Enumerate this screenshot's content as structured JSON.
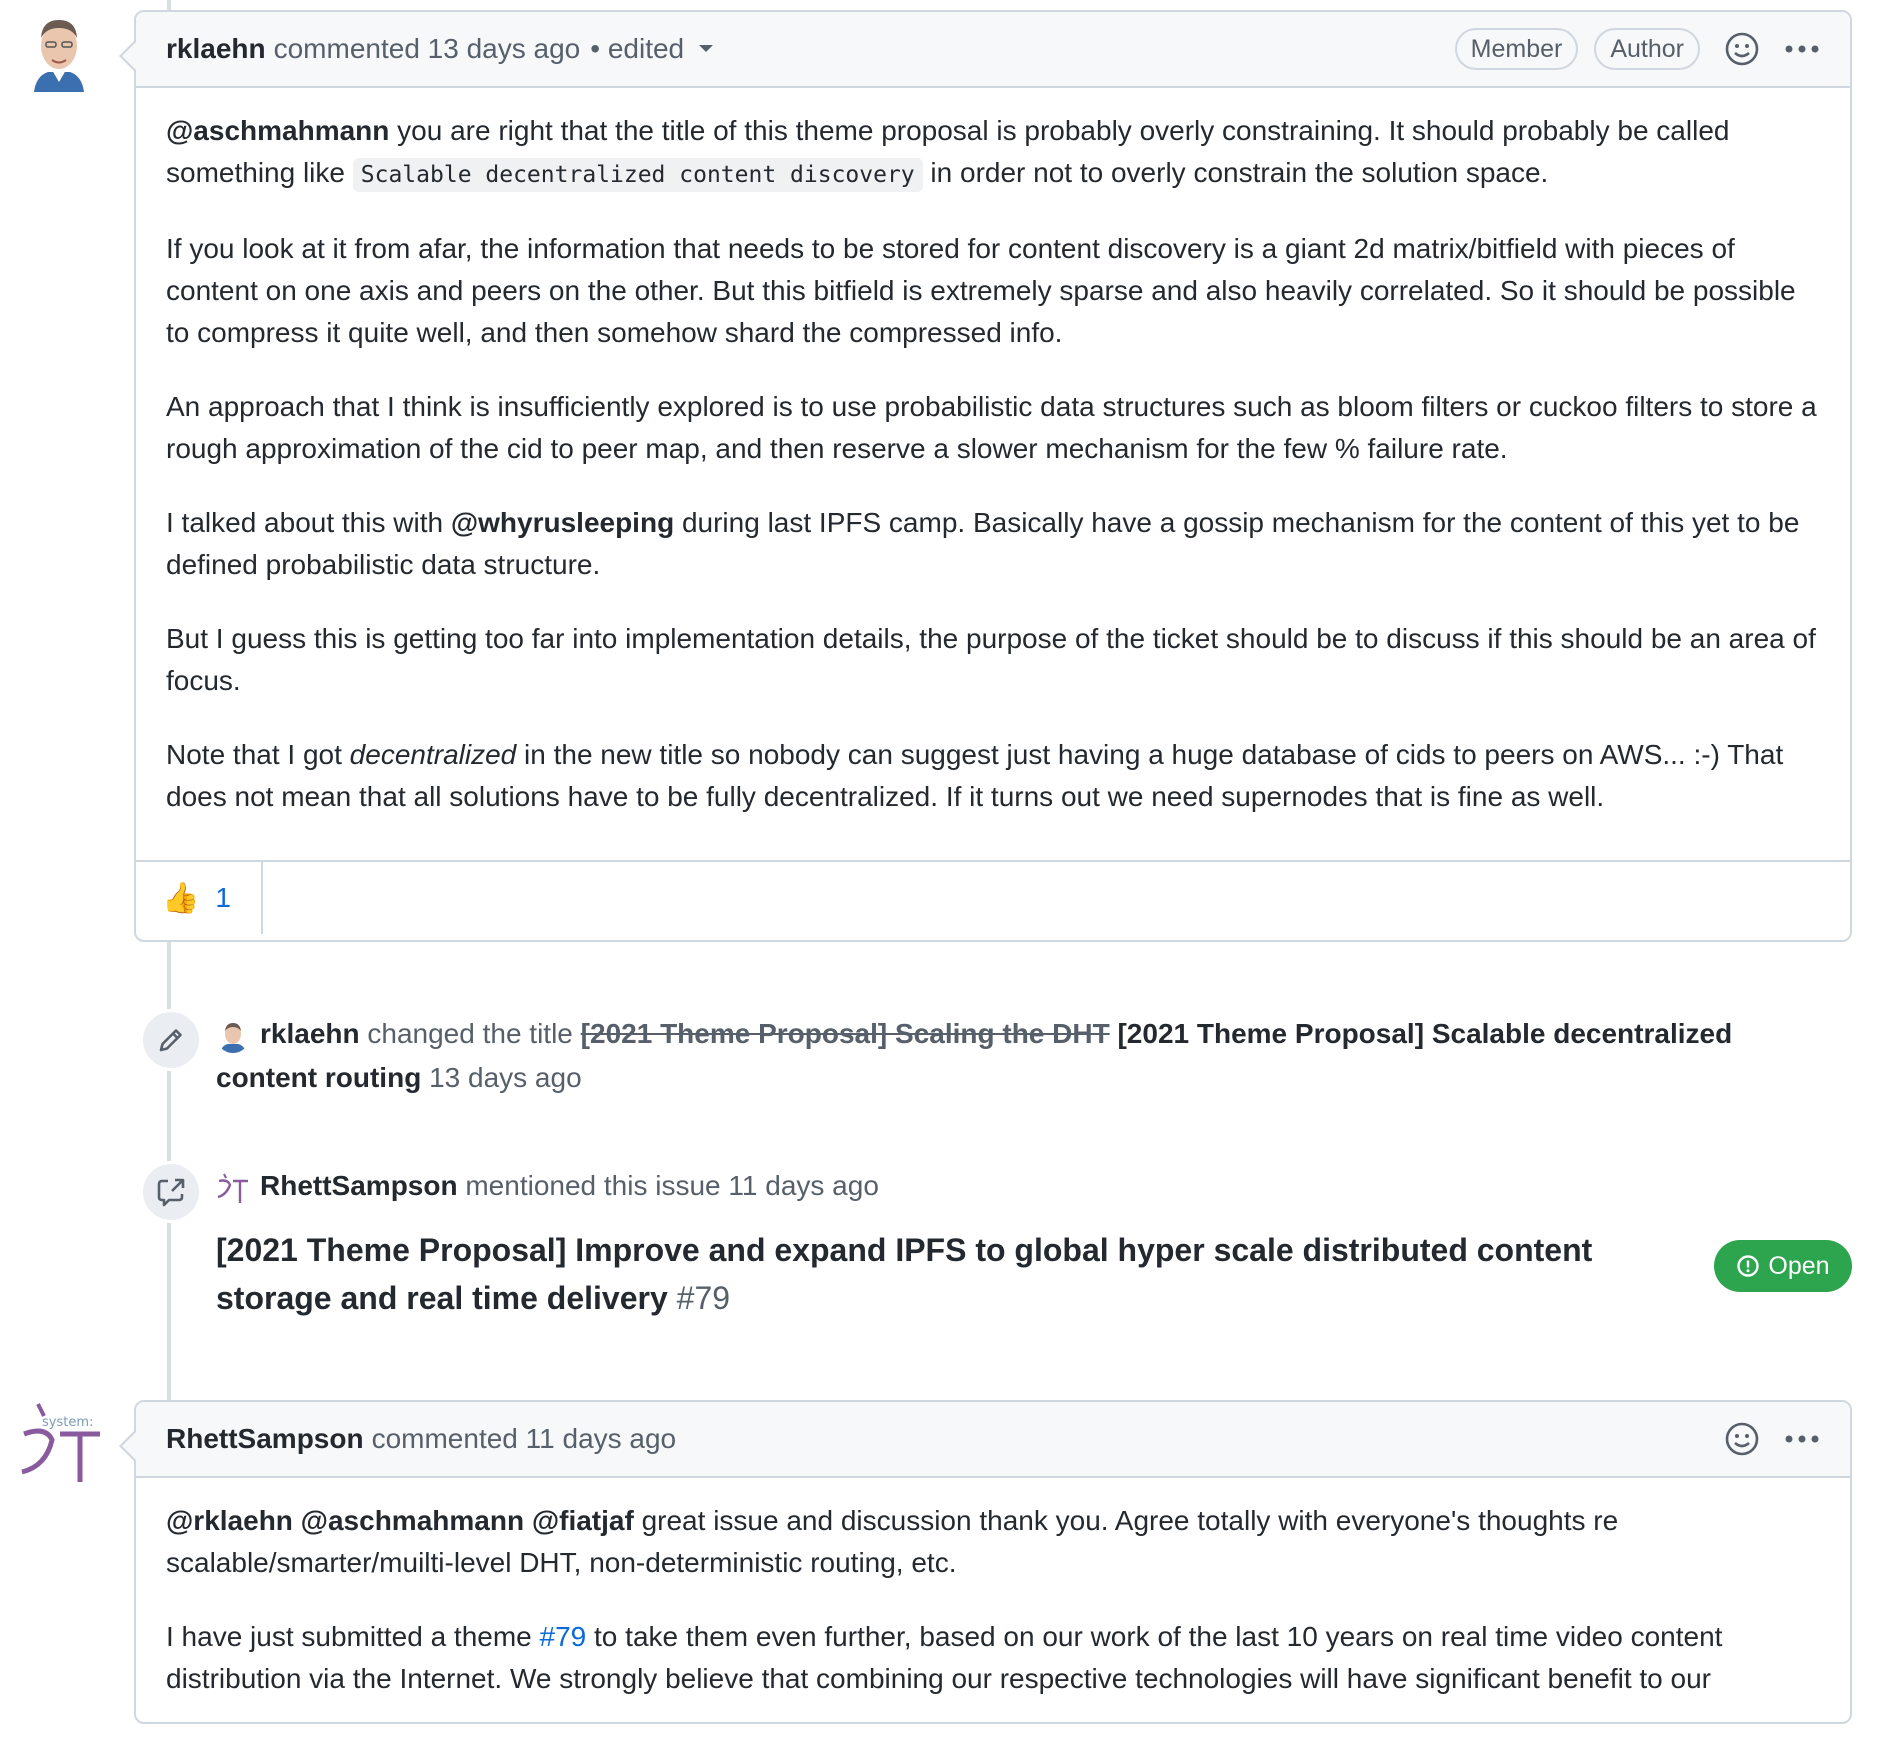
{
  "comment1": {
    "author": "rklaehn",
    "meta": "commented 13 days ago",
    "edited": "• edited",
    "badges": [
      "Member",
      "Author"
    ],
    "p1": {
      "mention": "@aschmahmann",
      "text_a": " you are right that the title of this theme proposal is probably overly constraining. It should probably be called something like ",
      "code": "Scalable decentralized content discovery",
      "text_b": " in order not to overly constrain the solution space."
    },
    "p2": "If you look at it from afar, the information that needs to be stored for content discovery is a giant 2d matrix/bitfield with pieces of content on one axis and peers on the other. But this bitfield is extremely sparse and also heavily correlated. So it should be possible to compress it quite well, and then somehow shard the compressed info.",
    "p3": "An approach that I think is insufficiently explored is to use probabilistic data structures such as bloom filters or cuckoo filters to store a rough approximation of the cid to peer map, and then reserve a slower mechanism for the few % failure rate.",
    "p4": {
      "text_a": "I talked about this with ",
      "mention": "@whyrusleeping",
      "text_b": " during last IPFS camp. Basically have a gossip mechanism for the content of this yet to be defined probabilistic data structure."
    },
    "p5": "But I guess this is getting too far into implementation details, the purpose of the ticket should be to discuss if this should be an area of focus.",
    "p6": {
      "text_a": "Note that I got ",
      "em": "decentralized",
      "text_b": " in the new title so nobody can suggest just having a huge database of cids to peers on AWS... :-) That does not mean that all solutions have to be fully decentralized. If it turns out we need supernodes that is fine as well."
    },
    "reaction": {
      "emoji": "👍",
      "count": "1"
    }
  },
  "event_rename": {
    "author": "rklaehn",
    "action": "changed the title",
    "old_title": "[2021 Theme Proposal] Scaling the DHT",
    "new_title": "[2021 Theme Proposal] Scalable decentralized content routing",
    "time": "13 days ago"
  },
  "event_mention": {
    "author": "RhettSampson",
    "action": "mentioned this issue",
    "time": "11 days ago",
    "ref_title": "[2021 Theme Proposal] Improve and expand IPFS to global hyper scale distributed content storage and real time delivery",
    "ref_number": "#79",
    "status": "Open"
  },
  "comment2": {
    "author": "RhettSampson",
    "meta": "commented 11 days ago",
    "avatar_text": "system:",
    "p1": {
      "mentions": "@rklaehn @aschmahmann @fiatjaf",
      "text": " great issue and discussion thank you. Agree totally with everyone's thoughts re scalable/smarter/muilti-level DHT, non-deterministic routing, etc."
    },
    "p2": {
      "text_a": "I have just submitted a theme ",
      "link": "#79",
      "text_b": " to take them even further, based on our work of the last 10 years on real time video content distribution via the Internet. We strongly believe that combining our respective technologies will have significant benefit to our"
    }
  }
}
